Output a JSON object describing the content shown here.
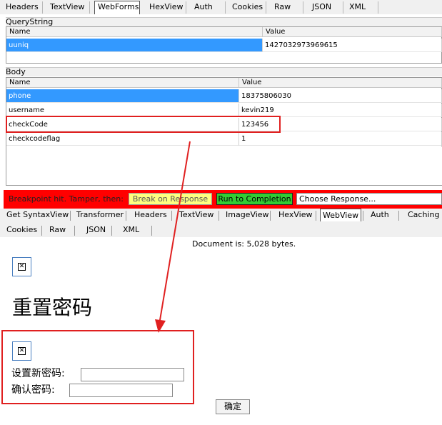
{
  "request_tabs": [
    "Headers",
    "TextView",
    "WebForms",
    "HexView",
    "Auth",
    "Cookies",
    "Raw",
    "JSON",
    "XML"
  ],
  "querystring": {
    "title": "QueryString",
    "col_name": "Name",
    "col_value": "Value",
    "rows": [
      {
        "name": "uuniq",
        "value": "1427032973969615"
      }
    ]
  },
  "body": {
    "title": "Body",
    "col_name": "Name",
    "col_value": "Value",
    "rows": [
      {
        "name": "phone",
        "value": "18375806030"
      },
      {
        "name": "username",
        "value": "kevin219"
      },
      {
        "name": "checkCode",
        "value": "123456"
      },
      {
        "name": "checkcodeflag",
        "value": "1"
      }
    ]
  },
  "breakpoint": {
    "label": "Breakpoint hit. Tamper, then:",
    "break_on_response": "Break on Response",
    "run_to_completion": "Run to Completion",
    "choose_response": "Choose Response..."
  },
  "response_tabs_row1": [
    "Get SyntaxView",
    "Transformer",
    "Headers",
    "TextView",
    "ImageView",
    "HexView",
    "WebView",
    "Auth",
    "Caching"
  ],
  "response_tabs_row2": [
    "Cookies",
    "Raw",
    "JSON",
    "XML"
  ],
  "document_info": "Document is: 5,028 bytes.",
  "webview": {
    "heading": "重置密码",
    "new_password_label": "设置新密码:",
    "confirm_password_label": "确认密码:",
    "submit_label": "确定"
  },
  "colors": {
    "selection": "#3399ff",
    "breakpoint_bar": "#ff0000",
    "annotation": "#e02020",
    "run_button": "#33cc33",
    "break_button": "#ffff80"
  }
}
